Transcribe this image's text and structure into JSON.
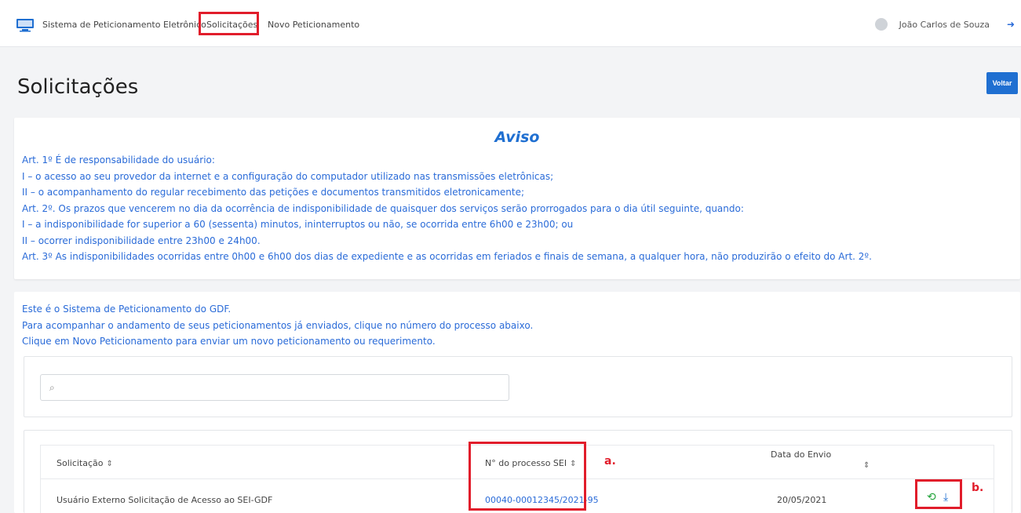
{
  "navbar": {
    "brand": "Sistema de Peticionamento Eletrônico",
    "solicitacoes": "Solicitações",
    "novo": "Novo Peticionamento",
    "user": "João Carlos de Souza"
  },
  "page": {
    "title": "Solicitações",
    "back_label": "Voltar"
  },
  "aviso": {
    "title": "Aviso",
    "lines": [
      "Art. 1º É de responsabilidade do usuário:",
      "I – o acesso ao seu provedor da internet e a configuração do computador utilizado nas transmissões eletrônicas;",
      "II – o acompanhamento do regular recebimento das petições e documentos transmitidos eletronicamente;",
      "Art. 2º. Os prazos que vencerem no dia da ocorrência de indisponibilidade de quaisquer dos serviços serão prorrogados para o dia útil seguinte, quando:",
      "I – a indisponibilidade for superior a 60 (sessenta) minutos, ininterruptos ou não, se ocorrida entre 6h00 e 23h00; ou",
      "II – ocorrer indisponibilidade entre 23h00 e 24h00.",
      "Art. 3º As indisponibilidades ocorridas entre 0h00 e 6h00 dos dias de expediente e as ocorridas em feriados e finais de semana, a qualquer hora, não produzirão o efeito do Art. 2º."
    ]
  },
  "intro": {
    "lines": [
      "Este é o Sistema de Peticionamento do GDF.",
      "Para acompanhar o andamento de seus peticionamentos já enviados, clique no número do processo abaixo.",
      "Clique em Novo Peticionamento para enviar um novo peticionamento ou requerimento."
    ]
  },
  "search": {
    "value": "",
    "placeholder": ""
  },
  "table": {
    "headers": {
      "solicitacao": "Solicitação",
      "processo": "N° do processo SEI",
      "data_envio": "Data do Envio"
    },
    "rows": [
      {
        "solicitacao": "Usuário Externo Solicitação de Acesso ao SEI-GDF",
        "processo": "00040-00012345/2021-95",
        "data": "20/05/2021"
      }
    ]
  },
  "annotations": {
    "a": "a.",
    "b": "b."
  },
  "icons": {
    "brand": "monitor-icon",
    "search": "search-icon",
    "sort": "sort-icon",
    "history": "history-icon",
    "download": "download-icon",
    "logout": "logout-icon",
    "avatar": "user-avatar-icon"
  },
  "colors": {
    "accent_blue": "#1f6fd1",
    "text_blue": "#2a6bd8",
    "annotation_red": "#e11d2b",
    "history_green": "#22a33a"
  }
}
